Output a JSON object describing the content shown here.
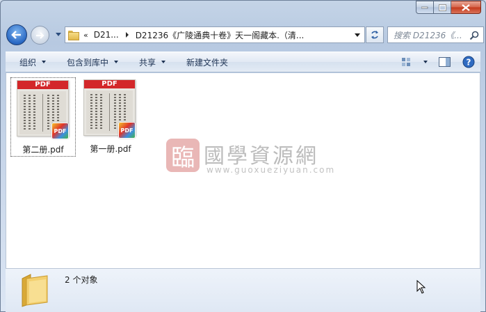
{
  "window": {
    "caption_buttons": [
      "minimize",
      "maximize",
      "close"
    ]
  },
  "nav": {
    "breadcrumb_overflow": "«",
    "breadcrumb_1": "D21...",
    "breadcrumb_2": "D21236《广陵通典十卷》天一阁藏本.（清...",
    "search_placeholder": "搜索 D21236《..."
  },
  "toolbar": {
    "organize": "组织",
    "include_library": "包含到库中",
    "share": "共享",
    "new_folder": "新建文件夹"
  },
  "files": [
    {
      "label": "第二册.pdf",
      "thumb_header": "PDF",
      "badge": "PDF",
      "selected": true
    },
    {
      "label": "第一册.pdf",
      "thumb_header": "PDF",
      "badge": "PDF",
      "selected": false
    }
  ],
  "watermark": {
    "seal": "臨",
    "title": "國學資源網",
    "url": "www.guoxueziyuan.com"
  },
  "status": {
    "count_text": "2 个对象"
  },
  "colors": {
    "pdf_red": "#d3272a",
    "window_frame": "#b7c9e1",
    "close_button": "#c4391b"
  }
}
